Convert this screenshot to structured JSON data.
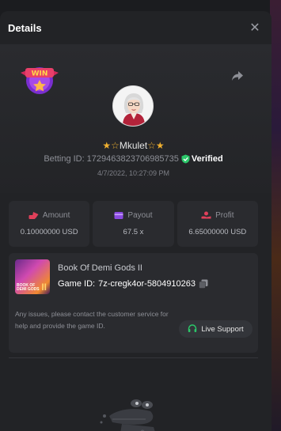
{
  "header": {
    "title": "Details"
  },
  "bet": {
    "username_left_stars": "★☆",
    "username": "Mkulet",
    "username_right_stars": "☆★",
    "betting_id_label": "Betting ID:",
    "betting_id": "1729463823706985735",
    "verified_label": "Verified",
    "timestamp": "4/7/2022, 10:27:09 PM"
  },
  "stats": {
    "amount": {
      "label": "Amount",
      "value": "0.10000000 USD"
    },
    "payout": {
      "label": "Payout",
      "value": "67.5 x"
    },
    "profit": {
      "label": "Profit",
      "value": "6.65000000 USD"
    }
  },
  "game": {
    "name": "Book Of Demi Gods II",
    "id_label": "Game ID:",
    "id": "7z-cregk4or-5804910263",
    "thumb_text_1": "BOOK OF",
    "thumb_text_2": "DEMI GODS",
    "thumb_numeral": "II",
    "help_text": "Any issues, please contact the customer service for help and provide the game ID.",
    "support_label": "Live Support"
  },
  "badge": {
    "text": "WIN"
  },
  "colors": {
    "accent_green": "#2bc769",
    "star_gold": "#f0b030",
    "amount_icon": "#e0405a",
    "payout_icon": "#8a4ae0",
    "profit_icon": "#e0405a"
  },
  "icons": {
    "close": "close-icon",
    "share": "share-icon",
    "shield": "shield-check-icon",
    "amount": "coins-icon",
    "payout": "wallet-icon",
    "profit": "money-hand-icon",
    "copy": "copy-icon",
    "support": "headset-icon"
  }
}
